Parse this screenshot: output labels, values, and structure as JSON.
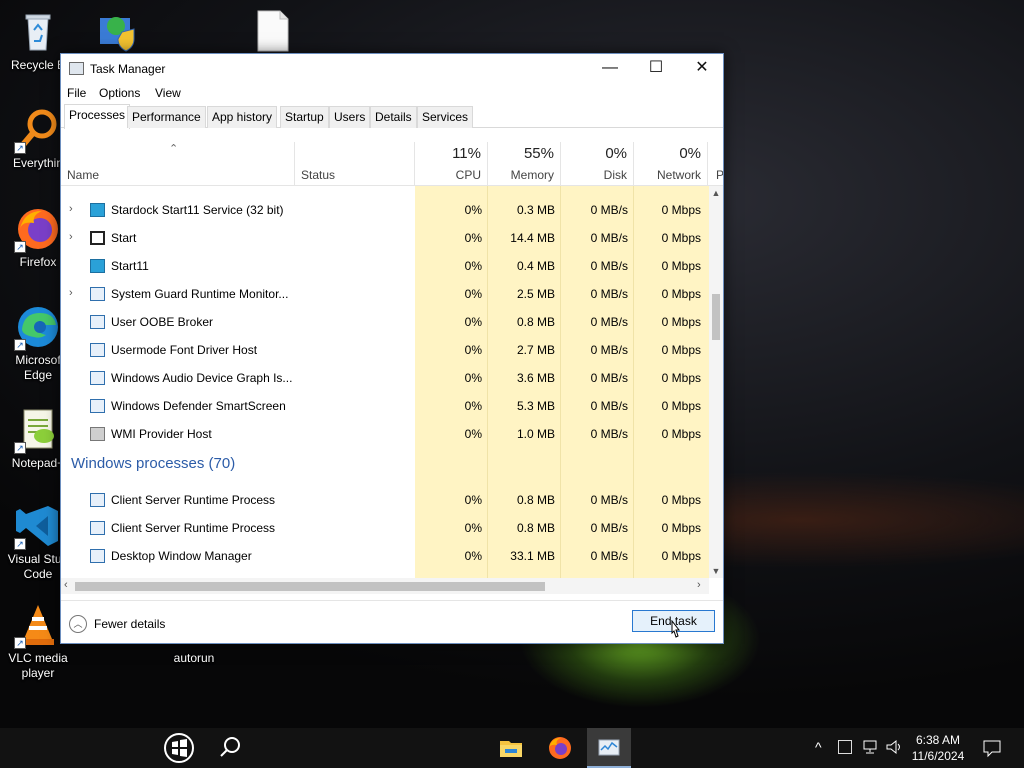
{
  "desktop": {
    "icons": [
      {
        "label": "Recycle B",
        "icon": "recycle-bin-icon"
      },
      {
        "label": "Everythin",
        "icon": "everything-search-icon"
      },
      {
        "label": "Firefox",
        "icon": "firefox-icon"
      },
      {
        "label": "Microsof",
        "label2": "Edge",
        "icon": "edge-icon"
      },
      {
        "label": "Notepad+",
        "icon": "notepadpp-icon"
      },
      {
        "label": "Visual Stud",
        "label2": "Code",
        "icon": "vscode-icon"
      },
      {
        "label": "VLC media",
        "label2": "player",
        "icon": "vlc-icon"
      },
      {
        "label": "autorun",
        "icon": "autorun-icon"
      }
    ]
  },
  "window": {
    "title": "Task Manager",
    "controls": {
      "minimize": "—",
      "maximize": "☐",
      "close": "✕"
    }
  },
  "menu": [
    "File",
    "Options",
    "View"
  ],
  "tabs": [
    "Processes",
    "Performance",
    "App history",
    "Startup",
    "Users",
    "Details",
    "Services"
  ],
  "columns": {
    "name": "Name",
    "status": "Status",
    "cpu": {
      "pct": "11%",
      "label": "CPU"
    },
    "memory": {
      "pct": "55%",
      "label": "Memory"
    },
    "disk": {
      "pct": "0%",
      "label": "Disk"
    },
    "network": {
      "pct": "0%",
      "label": "Network"
    },
    "partial": "P"
  },
  "rows": [
    {
      "name": "Stardock Start11 Service (32 bit)",
      "cpu": "0%",
      "mem": "0.3 MB",
      "disk": "0 MB/s",
      "net": "0 Mbps",
      "expand": "›",
      "icon": "start11"
    },
    {
      "name": "Start",
      "cpu": "0%",
      "mem": "14.4 MB",
      "disk": "0 MB/s",
      "net": "0 Mbps",
      "expand": "›",
      "icon": "start"
    },
    {
      "name": "Start11",
      "cpu": "0%",
      "mem": "0.4 MB",
      "disk": "0 MB/s",
      "net": "0 Mbps",
      "expand": "",
      "icon": "start11"
    },
    {
      "name": "System Guard Runtime Monitor...",
      "cpu": "0%",
      "mem": "2.5 MB",
      "disk": "0 MB/s",
      "net": "0 Mbps",
      "expand": "›",
      "icon": "app"
    },
    {
      "name": "User OOBE Broker",
      "cpu": "0%",
      "mem": "0.8 MB",
      "disk": "0 MB/s",
      "net": "0 Mbps",
      "expand": "",
      "icon": "app"
    },
    {
      "name": "Usermode Font Driver Host",
      "cpu": "0%",
      "mem": "2.7 MB",
      "disk": "0 MB/s",
      "net": "0 Mbps",
      "expand": "",
      "icon": "app"
    },
    {
      "name": "Windows Audio Device Graph Is...",
      "cpu": "0%",
      "mem": "3.6 MB",
      "disk": "0 MB/s",
      "net": "0 Mbps",
      "expand": "",
      "icon": "app"
    },
    {
      "name": "Windows Defender SmartScreen",
      "cpu": "0%",
      "mem": "5.3 MB",
      "disk": "0 MB/s",
      "net": "0 Mbps",
      "expand": "",
      "icon": "app"
    },
    {
      "name": "WMI Provider Host",
      "cpu": "0%",
      "mem": "1.0 MB",
      "disk": "0 MB/s",
      "net": "0 Mbps",
      "expand": "",
      "icon": "wmi"
    }
  ],
  "group": {
    "title": "Windows processes (70)"
  },
  "rows2": [
    {
      "name": "Client Server Runtime Process",
      "cpu": "0%",
      "mem": "0.8 MB",
      "disk": "0 MB/s",
      "net": "0 Mbps",
      "icon": "app"
    },
    {
      "name": "Client Server Runtime Process",
      "cpu": "0%",
      "mem": "0.8 MB",
      "disk": "0 MB/s",
      "net": "0 Mbps",
      "icon": "app"
    },
    {
      "name": "Desktop Window Manager",
      "cpu": "0%",
      "mem": "33.1 MB",
      "disk": "0 MB/s",
      "net": "0 Mbps",
      "icon": "app"
    }
  ],
  "footer": {
    "fewer_details": "Fewer details",
    "end_task": "End task"
  },
  "taskbar": {
    "start_icon": "windows-start-icon",
    "search_icon": "search-icon",
    "apps": [
      "file-explorer-icon",
      "firefox-icon",
      "task-manager-icon"
    ],
    "tray": {
      "chevron": "^",
      "time": "6:38 AM",
      "date": "11/6/2024"
    }
  },
  "colors": {
    "heat_column": "#fff4c4",
    "group_title": "#2c5ca8",
    "end_task_border": "#2878d0"
  }
}
